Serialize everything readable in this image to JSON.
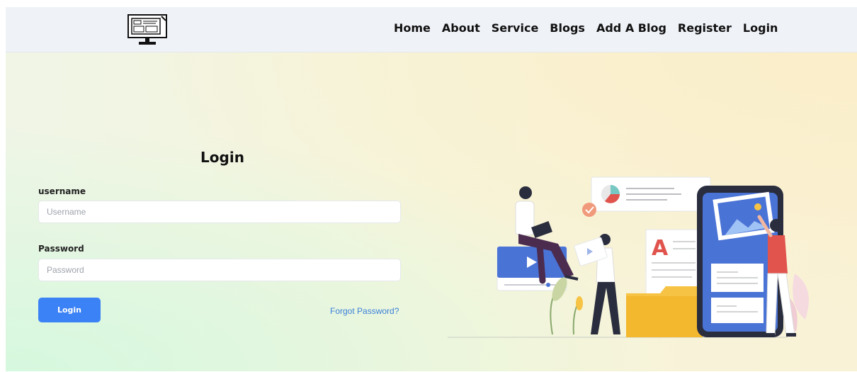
{
  "nav": {
    "logo_icon": "monitor-icon",
    "links": [
      "Home",
      "About",
      "Service",
      "Blogs",
      "Add A Blog",
      "Register",
      "Login"
    ]
  },
  "form": {
    "title": "Login",
    "username_label": "username",
    "username_placeholder": "Username",
    "username_value": "",
    "password_label": "Password",
    "password_placeholder": "Password",
    "password_value": "",
    "submit_label": "Login",
    "forgot_label": "Forgot Password?"
  },
  "illustration": {
    "name": "team-content-illustration",
    "doc_letter": "A"
  },
  "colors": {
    "primary": "#3b82f6",
    "link": "#3b7fd9",
    "navbar_bg": "#eff2f7",
    "phone_screen": "#4a73d6",
    "folder": "#f7c344",
    "accent_red": "#e0544d"
  }
}
